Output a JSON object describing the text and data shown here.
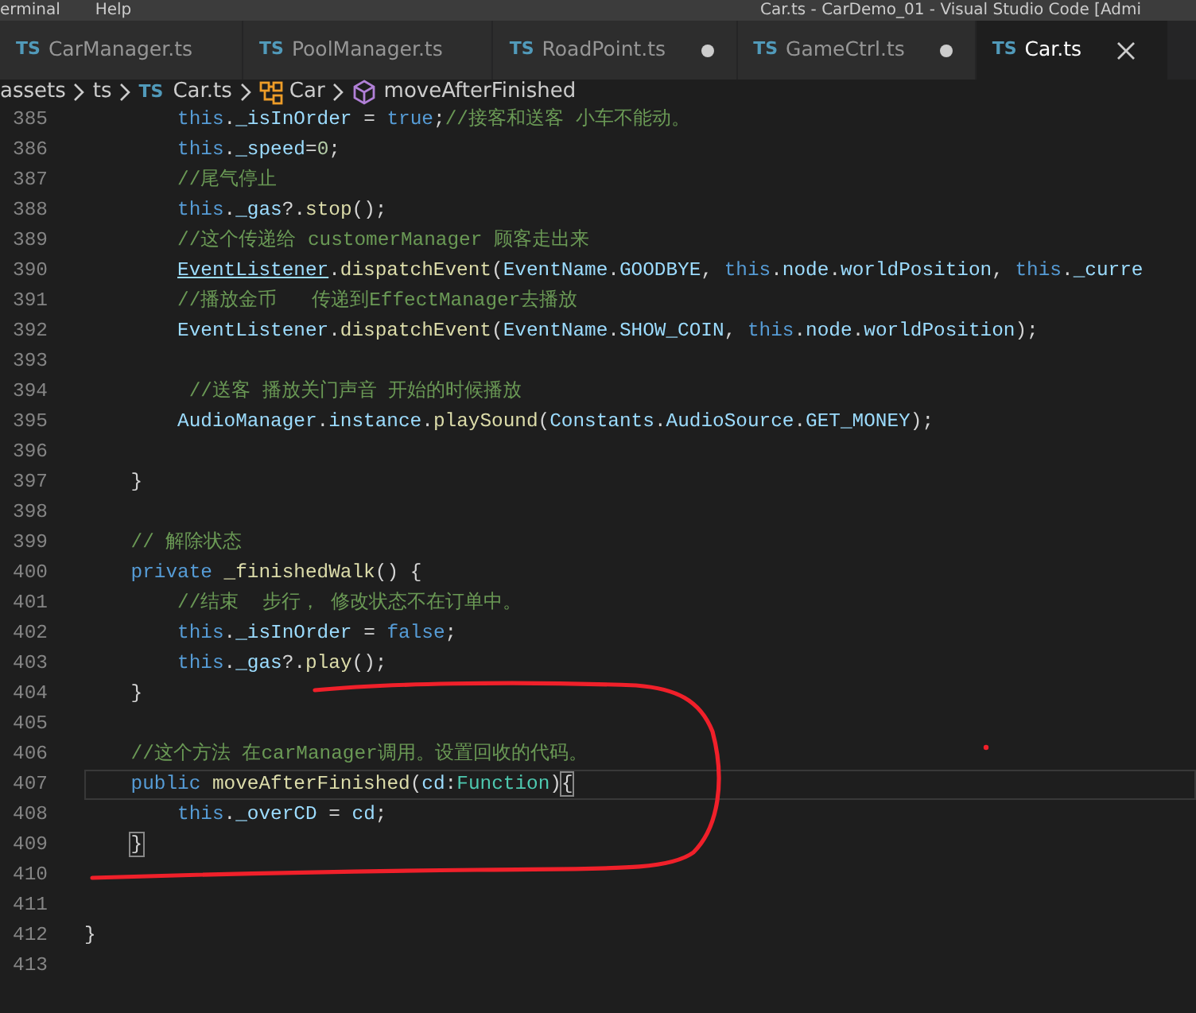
{
  "menu": {
    "items": [
      "erminal",
      "Help"
    ],
    "window_title": "Car.ts - CarDemo_01 - Visual Studio Code [Admi"
  },
  "tabs": [
    {
      "badge": "TS",
      "label": "CarManager.ts",
      "selected": false,
      "modified": false
    },
    {
      "badge": "TS",
      "label": "PoolManager.ts",
      "selected": false,
      "modified": false
    },
    {
      "badge": "TS",
      "label": "RoadPoint.ts",
      "selected": false,
      "modified": true
    },
    {
      "badge": "TS",
      "label": "GameCtrl.ts",
      "selected": false,
      "modified": true
    },
    {
      "badge": "TS",
      "label": "Car.ts",
      "selected": true,
      "modified": false
    }
  ],
  "breadcrumb": [
    {
      "kind": "folder",
      "label": "assets"
    },
    {
      "kind": "folder",
      "label": "ts"
    },
    {
      "kind": "file",
      "badge": "TS",
      "label": "Car.ts"
    },
    {
      "kind": "class",
      "label": "Car"
    },
    {
      "kind": "method",
      "label": "moveAfterFinished"
    }
  ],
  "editor": {
    "lines": [
      {
        "number": "385",
        "current": false,
        "tokens": [
          {
            "text": "        this",
            "kind": "keyword"
          },
          {
            "text": ".",
            "kind": "plain"
          },
          {
            "text": "_isInOrder",
            "kind": "variable"
          },
          {
            "text": " = ",
            "kind": "plain"
          },
          {
            "text": "true",
            "kind": "keyword"
          },
          {
            "text": ";",
            "kind": "plain"
          },
          {
            "text": "//接客和送客 小车不能动。",
            "kind": "comment"
          }
        ]
      },
      {
        "number": "386",
        "current": false,
        "tokens": [
          {
            "text": "        this",
            "kind": "keyword"
          },
          {
            "text": ".",
            "kind": "plain"
          },
          {
            "text": "_speed",
            "kind": "variable"
          },
          {
            "text": "=",
            "kind": "plain"
          },
          {
            "text": "0",
            "kind": "number"
          },
          {
            "text": ";",
            "kind": "plain"
          }
        ]
      },
      {
        "number": "387",
        "current": false,
        "tokens": [
          {
            "text": "        //尾气停止",
            "kind": "comment"
          }
        ]
      },
      {
        "number": "388",
        "current": false,
        "tokens": [
          {
            "text": "        this",
            "kind": "keyword"
          },
          {
            "text": ".",
            "kind": "plain"
          },
          {
            "text": "_gas",
            "kind": "variable"
          },
          {
            "text": "?.",
            "kind": "plain"
          },
          {
            "text": "stop",
            "kind": "function"
          },
          {
            "text": "();",
            "kind": "plain"
          }
        ]
      },
      {
        "number": "389",
        "current": false,
        "tokens": [
          {
            "text": "        //这个传递给 customerManager 顾客走出来",
            "kind": "comment"
          }
        ]
      },
      {
        "number": "390",
        "current": false,
        "tokens": [
          {
            "text": "        EventListener",
            "kind": "link"
          },
          {
            "text": ".",
            "kind": "plain"
          },
          {
            "text": "dispatchEvent",
            "kind": "function"
          },
          {
            "text": "(",
            "kind": "plain"
          },
          {
            "text": "EventName",
            "kind": "variable"
          },
          {
            "text": ".",
            "kind": "plain"
          },
          {
            "text": "GOODBYE",
            "kind": "variable"
          },
          {
            "text": ", ",
            "kind": "plain"
          },
          {
            "text": "this",
            "kind": "keyword"
          },
          {
            "text": ".",
            "kind": "plain"
          },
          {
            "text": "node",
            "kind": "variable"
          },
          {
            "text": ".",
            "kind": "plain"
          },
          {
            "text": "worldPosition",
            "kind": "variable"
          },
          {
            "text": ", ",
            "kind": "plain"
          },
          {
            "text": "this",
            "kind": "keyword"
          },
          {
            "text": ".",
            "kind": "plain"
          },
          {
            "text": "_curre",
            "kind": "variable"
          }
        ]
      },
      {
        "number": "391",
        "current": false,
        "tokens": [
          {
            "text": "        //播放金币   传递到EffectManager去播放",
            "kind": "comment"
          }
        ]
      },
      {
        "number": "392",
        "current": false,
        "tokens": [
          {
            "text": "        EventListener",
            "kind": "variable"
          },
          {
            "text": ".",
            "kind": "plain"
          },
          {
            "text": "dispatchEvent",
            "kind": "function"
          },
          {
            "text": "(",
            "kind": "plain"
          },
          {
            "text": "EventName",
            "kind": "variable"
          },
          {
            "text": ".",
            "kind": "plain"
          },
          {
            "text": "SHOW_COIN",
            "kind": "variable"
          },
          {
            "text": ", ",
            "kind": "plain"
          },
          {
            "text": "this",
            "kind": "keyword"
          },
          {
            "text": ".",
            "kind": "plain"
          },
          {
            "text": "node",
            "kind": "variable"
          },
          {
            "text": ".",
            "kind": "plain"
          },
          {
            "text": "worldPosition",
            "kind": "variable"
          },
          {
            "text": ");",
            "kind": "plain"
          }
        ]
      },
      {
        "number": "393",
        "current": false
      },
      {
        "number": "394",
        "current": false,
        "tokens": [
          {
            "text": "         //送客 播放关门声音 开始的时候播放",
            "kind": "comment"
          }
        ]
      },
      {
        "number": "395",
        "current": false,
        "tokens": [
          {
            "text": "        AudioManager",
            "kind": "variable"
          },
          {
            "text": ".",
            "kind": "plain"
          },
          {
            "text": "instance",
            "kind": "variable"
          },
          {
            "text": ".",
            "kind": "plain"
          },
          {
            "text": "playSound",
            "kind": "function"
          },
          {
            "text": "(",
            "kind": "plain"
          },
          {
            "text": "Constants",
            "kind": "variable"
          },
          {
            "text": ".",
            "kind": "plain"
          },
          {
            "text": "AudioSource",
            "kind": "variable"
          },
          {
            "text": ".",
            "kind": "plain"
          },
          {
            "text": "GET_MONEY",
            "kind": "variable"
          },
          {
            "text": ");",
            "kind": "plain"
          }
        ]
      },
      {
        "number": "396",
        "current": false
      },
      {
        "number": "397",
        "current": false,
        "tokens": [
          {
            "text": "    }",
            "kind": "plain"
          }
        ]
      },
      {
        "number": "398",
        "current": false
      },
      {
        "number": "399",
        "current": false,
        "tokens": [
          {
            "text": "    // 解除状态",
            "kind": "comment"
          }
        ]
      },
      {
        "number": "400",
        "current": false,
        "tokens": [
          {
            "text": "    private",
            "kind": "keyword"
          },
          {
            "text": " _finishedWalk",
            "kind": "function"
          },
          {
            "text": "() {",
            "kind": "plain"
          }
        ]
      },
      {
        "number": "401",
        "current": false,
        "tokens": [
          {
            "text": "        //结束  步行， 修改状态不在订单中。",
            "kind": "comment"
          }
        ]
      },
      {
        "number": "402",
        "current": false,
        "tokens": [
          {
            "text": "        this",
            "kind": "keyword"
          },
          {
            "text": ".",
            "kind": "plain"
          },
          {
            "text": "_isInOrder",
            "kind": "variable"
          },
          {
            "text": " = ",
            "kind": "plain"
          },
          {
            "text": "false",
            "kind": "keyword"
          },
          {
            "text": ";",
            "kind": "plain"
          }
        ]
      },
      {
        "number": "403",
        "current": false,
        "tokens": [
          {
            "text": "        this",
            "kind": "keyword"
          },
          {
            "text": ".",
            "kind": "plain"
          },
          {
            "text": "_gas",
            "kind": "variable"
          },
          {
            "text": "?.",
            "kind": "plain"
          },
          {
            "text": "play",
            "kind": "function"
          },
          {
            "text": "();",
            "kind": "plain"
          }
        ]
      },
      {
        "number": "404",
        "current": false,
        "tokens": [
          {
            "text": "    }",
            "kind": "plain"
          }
        ]
      },
      {
        "number": "405",
        "current": false
      },
      {
        "number": "406",
        "current": false,
        "tokens": [
          {
            "text": "    //这个方法 在carManager调用。设置回收的代码。",
            "kind": "comment"
          }
        ]
      },
      {
        "number": "407",
        "current": true,
        "tokens": [
          {
            "text": "    public",
            "kind": "keyword"
          },
          {
            "text": " moveAfterFinished",
            "kind": "function"
          },
          {
            "text": "(",
            "kind": "plain"
          },
          {
            "text": "cd",
            "kind": "variable"
          },
          {
            "text": ":",
            "kind": "plain"
          },
          {
            "text": "Function",
            "kind": "type"
          },
          {
            "text": ")",
            "kind": "plain"
          },
          {
            "text": "{",
            "kind": "bracket"
          }
        ]
      },
      {
        "number": "408",
        "current": false,
        "tokens": [
          {
            "text": "        this",
            "kind": "keyword"
          },
          {
            "text": ".",
            "kind": "plain"
          },
          {
            "text": "_overCD",
            "kind": "variable"
          },
          {
            "text": " = ",
            "kind": "plain"
          },
          {
            "text": "cd",
            "kind": "variable"
          },
          {
            "text": ";",
            "kind": "plain"
          }
        ]
      },
      {
        "number": "409",
        "current": false,
        "tokens": [
          {
            "text": "    }",
            "kind": "bracket"
          }
        ]
      },
      {
        "number": "410",
        "current": false
      },
      {
        "number": "411",
        "current": false
      },
      {
        "number": "412",
        "current": false,
        "tokens": [
          {
            "text": "}",
            "kind": "plain"
          }
        ]
      },
      {
        "number": "413",
        "current": false
      }
    ]
  }
}
